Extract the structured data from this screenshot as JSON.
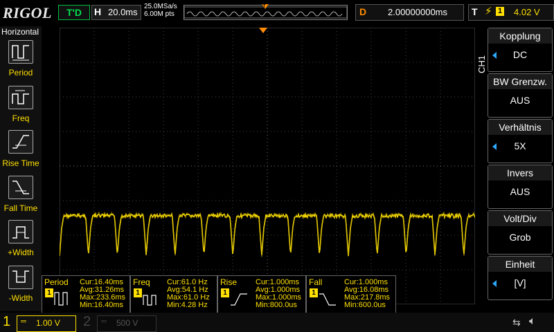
{
  "brand": "RIGOL",
  "top": {
    "trigger_status": "T'D",
    "horizontal_label": "H",
    "timebase": "20.0ms",
    "sample_rate": "25.0MSa/s",
    "memory_depth": "6.00M pts",
    "trigger_marker": "T",
    "delay_label": "D",
    "delay_value": "2.00000000ms",
    "trigger_label": "T",
    "trigger_source": "1",
    "trigger_level": "4.02 V"
  },
  "left_menu": {
    "title": "Horizontal",
    "items": [
      {
        "label": "Period",
        "icon": "period-icon"
      },
      {
        "label": "Freq",
        "icon": "frequency-icon"
      },
      {
        "label": "Rise Time",
        "icon": "rise-time-icon"
      },
      {
        "label": "Fall Time",
        "icon": "fall-time-icon"
      },
      {
        "label": "+Width",
        "icon": "positive-width-icon"
      },
      {
        "label": "-Width",
        "icon": "negative-width-icon"
      }
    ]
  },
  "right_menu": {
    "channel": "CH1",
    "items": [
      {
        "title": "Kopplung",
        "value": "DC",
        "has_arrow": true
      },
      {
        "title": "BW Grenzw.",
        "value": "AUS",
        "has_arrow": false
      },
      {
        "title": "Verhältnis",
        "value": "5X",
        "has_arrow": true
      },
      {
        "title": "Invers",
        "value": "AUS",
        "has_arrow": false
      },
      {
        "title": "Volt/Div",
        "value": "Grob",
        "has_arrow": false
      },
      {
        "title": "Einheit",
        "value": "[V]",
        "has_arrow": true
      }
    ]
  },
  "measurements": [
    {
      "name": "Period",
      "source": "1",
      "cur": "Cur:16.40ms",
      "avg": "Avg:31.26ms",
      "max": "Max:233.6ms",
      "min": "Min:16.40ms"
    },
    {
      "name": "Freq",
      "source": "1",
      "cur": "Cur:61.0 Hz",
      "avg": "Avg:54.1 Hz",
      "max": "Max:61.0 Hz",
      "min": "Min:4.28 Hz"
    },
    {
      "name": "Rise",
      "source": "1",
      "cur": "Cur:1.000ms",
      "avg": "Avg:1.000ms",
      "max": "Max:1.000ms",
      "min": "Min:800.0us"
    },
    {
      "name": "Fall",
      "source": "1",
      "cur": "Cur:1.000ms",
      "avg": "Avg:16.08ms",
      "max": "Max:217.8ms",
      "min": "Min:600.0us"
    }
  ],
  "bottom": {
    "ch1_number": "1",
    "ch1_scale": "1.00 V",
    "ch2_number": "2",
    "ch2_scale": "500 V"
  },
  "colors": {
    "ch1": "#ffe000",
    "trigger": "#ff8c00",
    "accent": "#2ea8ff",
    "status": "#00e050"
  }
}
